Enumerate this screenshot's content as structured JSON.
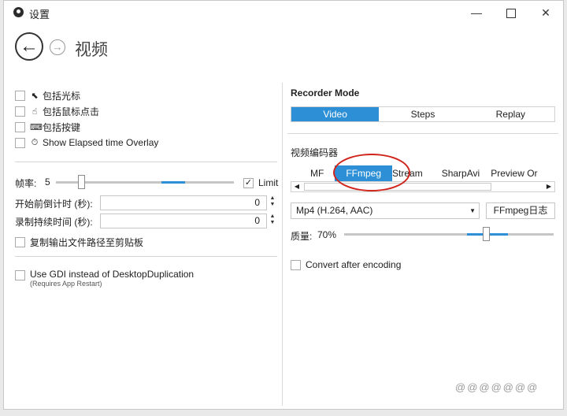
{
  "window": {
    "title": "设置"
  },
  "nav": {
    "page_title": "视频",
    "back_glyph": "←",
    "forward_glyph": "→"
  },
  "left": {
    "checkboxes": [
      {
        "label": "包括光标",
        "icon": "cursor-icon",
        "glyph": "⬉",
        "checked": false
      },
      {
        "label": "包括鼠标点击",
        "icon": "hand-pointer-icon",
        "glyph": "☝",
        "checked": false
      },
      {
        "label": "包括按键",
        "icon": "keyboard-icon",
        "glyph": "⌨",
        "checked": false
      },
      {
        "label": "Show Elapsed time Overlay",
        "icon": "stopwatch-icon",
        "glyph": "⏱",
        "checked": false
      }
    ],
    "frame_rate": {
      "label": "帧率:",
      "value": "5",
      "limit_label": "Limit",
      "limit_checked": true,
      "check_glyph": "✓"
    },
    "countdown": {
      "label": "开始前倒计时 (秒):",
      "value": "0"
    },
    "duration": {
      "label": "录制持续时间 (秒):",
      "value": "0"
    },
    "copy_path": {
      "label": "复制输出文件路径至剪贴板",
      "checked": false
    },
    "gdi": {
      "label": "Use GDI instead of DesktopDuplication",
      "note": "(Requires App Restart)",
      "checked": false
    }
  },
  "right": {
    "recorder_mode": {
      "title": "Recorder Mode",
      "options": [
        "Video",
        "Steps",
        "Replay"
      ],
      "selected": "Video"
    },
    "encoder": {
      "title": "视频编码器",
      "tabs": [
        "MF",
        "FFmpeg",
        "Stream",
        "SharpAvi",
        "Preview Or"
      ],
      "selected": "FFmpeg",
      "scroll_left": "◀",
      "scroll_right": "▶"
    },
    "format": {
      "value": "Mp4 (H.264, AAC)",
      "arrow": "▼"
    },
    "log_button": "FFmpeg日志",
    "quality": {
      "label": "质量:",
      "value": "70%"
    },
    "convert": {
      "label": "Convert after encoding",
      "checked": false
    }
  },
  "window_controls": {
    "minimize": "—",
    "close": "✕"
  },
  "watermark": "@@@@@@@"
}
